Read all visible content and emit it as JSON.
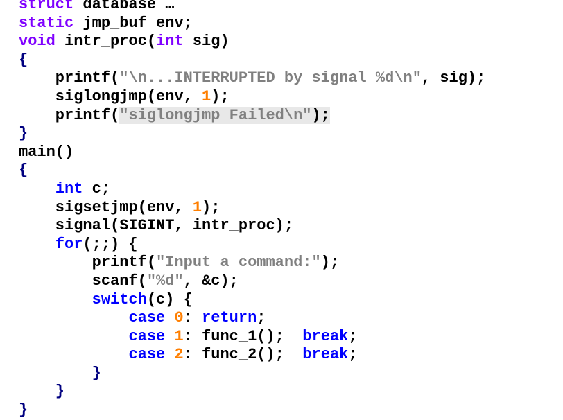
{
  "code": {
    "l1": {
      "a": "struct",
      "b": " database …"
    },
    "l2": {
      "a": "static",
      "b": " jmp_buf env;"
    },
    "l3": {
      "a": "void",
      "b": " intr_proc(",
      "c": "int",
      "d": " sig)"
    },
    "l4": {
      "a": "{"
    },
    "l5": {
      "a": "    printf(",
      "b": "\"\\n...INTERRUPTED by signal %d\\n\"",
      "c": ", sig);"
    },
    "l6": {
      "a": "    siglongjmp(env, ",
      "b": "1",
      "c": ");"
    },
    "l7": {
      "a": "    printf(",
      "b": "\"siglongjmp Failed\\n\"",
      "c": ");"
    },
    "l8": {
      "a": "}"
    },
    "l9": {
      "a": "main()"
    },
    "l10": {
      "a": "{"
    },
    "l11": {
      "a": "    ",
      "b": "int",
      "c": " c;"
    },
    "l12": {
      "a": "    sigsetjmp(env, ",
      "b": "1",
      "c": ");"
    },
    "l13": {
      "a": "    signal(SIGINT, intr_proc);"
    },
    "l14": {
      "a": "    ",
      "b": "for",
      "c": "(;;) {"
    },
    "l15": {
      "a": "        printf(",
      "b": "\"Input a command:\"",
      "c": ");"
    },
    "l16": {
      "a": "        scanf(",
      "b": "\"%d\"",
      "c": ", &c);"
    },
    "l17": {
      "a": "        ",
      "b": "switch",
      "c": "(c) {"
    },
    "l18": {
      "a": "            ",
      "b": "case",
      "c": " ",
      "d": "0",
      "e": ": ",
      "f": "return",
      "g": ";"
    },
    "l19": {
      "a": "            ",
      "b": "case",
      "c": " ",
      "d": "1",
      "e": ": func_1();  ",
      "f": "break",
      "g": ";"
    },
    "l20": {
      "a": "            ",
      "b": "case",
      "c": " ",
      "d": "2",
      "e": ": func_2();  ",
      "f": "break",
      "g": ";"
    },
    "l21": {
      "a": "        }"
    },
    "l22": {
      "a": "    }"
    },
    "l23": {
      "a": "}"
    }
  },
  "colors": {
    "keyword_purple": "#7f00ff",
    "keyword_blue": "#0000ff",
    "number": "#ff7f00",
    "string": "#808080",
    "text": "#000000"
  }
}
